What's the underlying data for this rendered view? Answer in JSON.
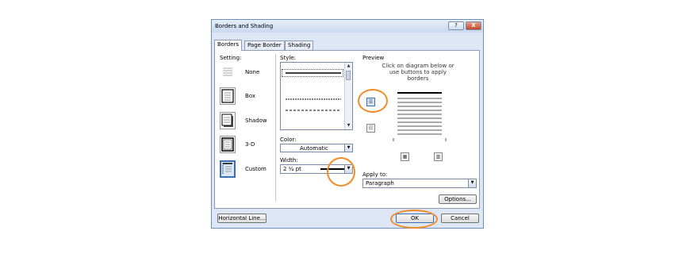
{
  "dialog": {
    "title": "Borders and Shading",
    "help_label": "?",
    "close_label": "X"
  },
  "tabs": [
    {
      "label": "Borders"
    },
    {
      "label": "Page Border"
    },
    {
      "label": "Shading"
    }
  ],
  "setting": {
    "heading": "Setting:",
    "options": [
      {
        "label": "None"
      },
      {
        "label": "Box"
      },
      {
        "label": "Shadow"
      },
      {
        "label": "3-D"
      },
      {
        "label": "Custom",
        "selected": true
      }
    ]
  },
  "style": {
    "heading": "Style:",
    "scroll_up": "▲",
    "scroll_down": "▼"
  },
  "color": {
    "heading": "Color:",
    "value": "Automatic"
  },
  "width": {
    "heading": "Width:",
    "value": "2 ¼ pt"
  },
  "preview": {
    "heading": "Preview",
    "instruction": "Click on diagram below or use buttons to apply borders"
  },
  "apply_to": {
    "heading": "Apply to:",
    "value": "Paragraph"
  },
  "buttons": {
    "options": "Options...",
    "horizontal_line": "Horizontal Line...",
    "ok": "OK",
    "cancel": "Cancel"
  },
  "highlight_color": "#f28c28",
  "accent_color": "#3b6fb5"
}
